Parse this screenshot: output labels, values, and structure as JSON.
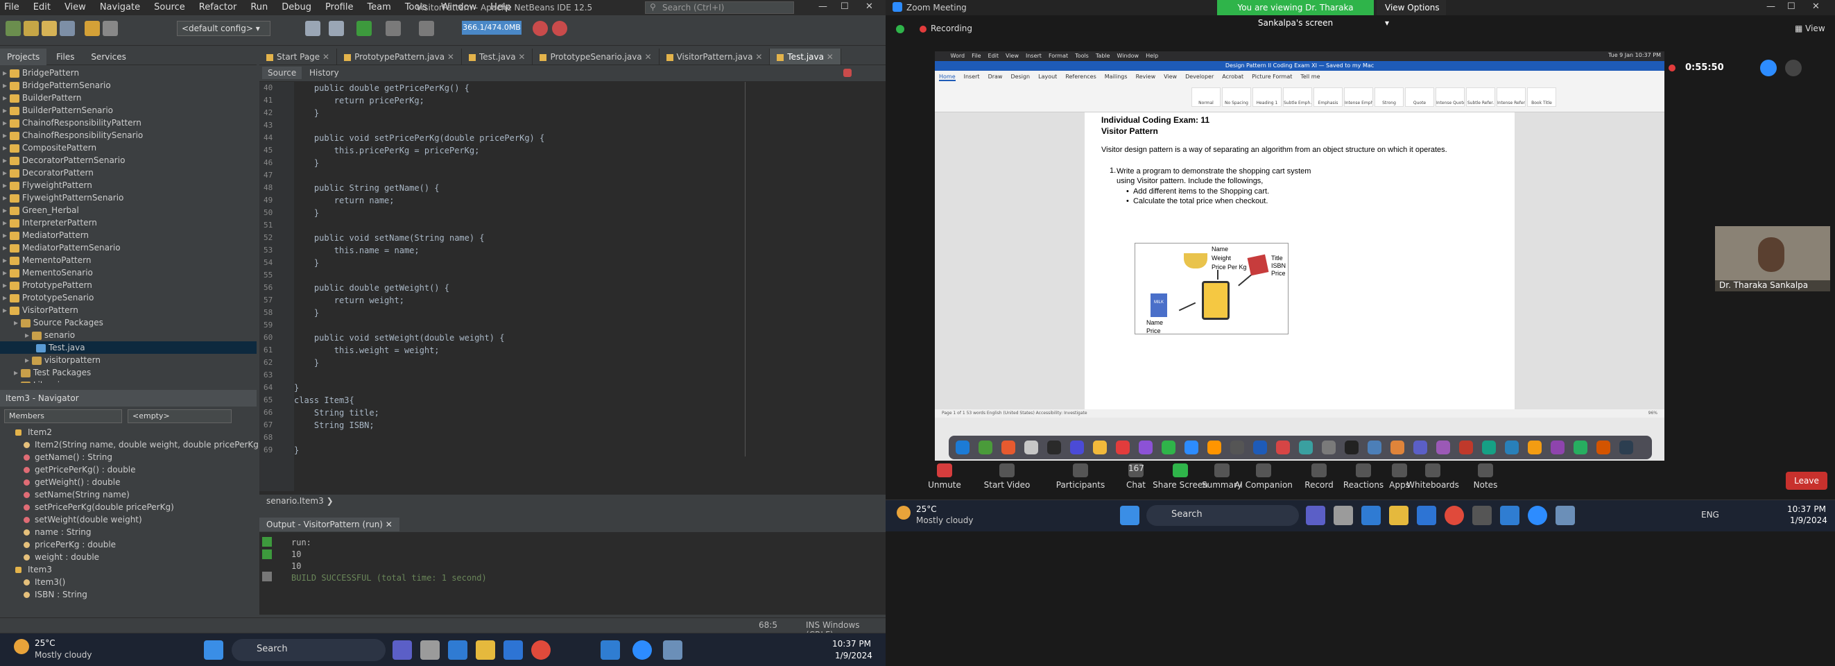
{
  "netbeans": {
    "window_title": "VisitorPattern - Apache NetBeans IDE 12.5",
    "menus": [
      "File",
      "Edit",
      "View",
      "Navigate",
      "Source",
      "Refactor",
      "Run",
      "Debug",
      "Profile",
      "Team",
      "Tools",
      "Window",
      "Help"
    ],
    "search_placeholder": "Search (Ctrl+I)",
    "config": "<default config>",
    "memory": "366.1/474.0MB",
    "panel_tabs": [
      "Projects",
      "Files",
      "Services"
    ],
    "tree": [
      {
        "label": "BridgePattern",
        "indent": 0,
        "type": "proj"
      },
      {
        "label": "BridgePatternSenario",
        "indent": 0,
        "type": "proj"
      },
      {
        "label": "BuilderPattern",
        "indent": 0,
        "type": "proj"
      },
      {
        "label": "BuilderPatternSenario",
        "indent": 0,
        "type": "proj"
      },
      {
        "label": "ChainofResponsibilityPattern",
        "indent": 0,
        "type": "proj"
      },
      {
        "label": "ChainofResponsibilitySenario",
        "indent": 0,
        "type": "proj"
      },
      {
        "label": "CompositePattern",
        "indent": 0,
        "type": "proj"
      },
      {
        "label": "DecoratorPatternSenario",
        "indent": 0,
        "type": "proj"
      },
      {
        "label": "DecoratorPattern",
        "indent": 0,
        "type": "proj"
      },
      {
        "label": "FlyweightPattern",
        "indent": 0,
        "type": "proj"
      },
      {
        "label": "FlyweightPatternSenario",
        "indent": 0,
        "type": "proj"
      },
      {
        "label": "Green_Herbal",
        "indent": 0,
        "type": "proj"
      },
      {
        "label": "InterpreterPattern",
        "indent": 0,
        "type": "proj"
      },
      {
        "label": "MediatorPattern",
        "indent": 0,
        "type": "proj"
      },
      {
        "label": "MediatorPatternSenario",
        "indent": 0,
        "type": "proj"
      },
      {
        "label": "MementoPattern",
        "indent": 0,
        "type": "proj"
      },
      {
        "label": "MementoSenario",
        "indent": 0,
        "type": "proj"
      },
      {
        "label": "PrototypePattern",
        "indent": 0,
        "type": "proj"
      },
      {
        "label": "PrototypeSenario",
        "indent": 0,
        "type": "proj"
      },
      {
        "label": "VisitorPattern",
        "indent": 0,
        "type": "proj"
      },
      {
        "label": "Source Packages",
        "indent": 1,
        "type": "pk"
      },
      {
        "label": "senario",
        "indent": 2,
        "type": "pk"
      },
      {
        "label": "Test.java",
        "indent": 3,
        "type": "jv"
      },
      {
        "label": "visitorpattern",
        "indent": 2,
        "type": "pk"
      },
      {
        "label": "Test Packages",
        "indent": 1,
        "type": "pk"
      },
      {
        "label": "Libraries",
        "indent": 1,
        "type": "pk"
      }
    ],
    "navigator": {
      "title": "Item3 - Navigator",
      "members_label": "Members",
      "empty_label": "<empty>",
      "items": [
        {
          "label": "Item2",
          "cls": true
        },
        {
          "label": "Item2(String name, double weight, double pricePerKg)",
          "k": "g"
        },
        {
          "label": "getName() : String",
          "k": "r"
        },
        {
          "label": "getPricePerKg() : double",
          "k": "r"
        },
        {
          "label": "getWeight() : double",
          "k": "r"
        },
        {
          "label": "setName(String name)",
          "k": "r"
        },
        {
          "label": "setPricePerKg(double pricePerKg)",
          "k": "r"
        },
        {
          "label": "setWeight(double weight)",
          "k": "r"
        },
        {
          "label": "name : String",
          "k": "g"
        },
        {
          "label": "pricePerKg : double",
          "k": "g"
        },
        {
          "label": "weight : double",
          "k": "g"
        },
        {
          "label": "Item3",
          "cls": true
        },
        {
          "label": "Item3()",
          "k": "g"
        },
        {
          "label": "ISBN : String",
          "k": "g"
        }
      ]
    },
    "editor_tabs": [
      "Start Page",
      "PrototypePattern.java",
      "Test.java",
      "PrototypeSenario.java",
      "VisitorPattern.java",
      "Test.java"
    ],
    "source_label": "Source",
    "history_label": "History",
    "code_lines": [
      {
        "n": "40",
        "t": "    public double getPricePerKg() {"
      },
      {
        "n": "41",
        "t": "        return pricePerKg;"
      },
      {
        "n": "42",
        "t": "    }"
      },
      {
        "n": "43",
        "t": ""
      },
      {
        "n": "44",
        "t": "    public void setPricePerKg(double pricePerKg) {"
      },
      {
        "n": "45",
        "t": "        this.pricePerKg = pricePerKg;"
      },
      {
        "n": "46",
        "t": "    }"
      },
      {
        "n": "47",
        "t": ""
      },
      {
        "n": "48",
        "t": "    public String getName() {"
      },
      {
        "n": "49",
        "t": "        return name;"
      },
      {
        "n": "50",
        "t": "    }"
      },
      {
        "n": "51",
        "t": ""
      },
      {
        "n": "52",
        "t": "    public void setName(String name) {"
      },
      {
        "n": "53",
        "t": "        this.name = name;"
      },
      {
        "n": "54",
        "t": "    }"
      },
      {
        "n": "55",
        "t": ""
      },
      {
        "n": "56",
        "t": "    public double getWeight() {"
      },
      {
        "n": "57",
        "t": "        return weight;"
      },
      {
        "n": "58",
        "t": "    }"
      },
      {
        "n": "59",
        "t": ""
      },
      {
        "n": "60",
        "t": "    public void setWeight(double weight) {"
      },
      {
        "n": "61",
        "t": "        this.weight = weight;"
      },
      {
        "n": "62",
        "t": "    }"
      },
      {
        "n": "63",
        "t": ""
      },
      {
        "n": "64",
        "t": "}"
      },
      {
        "n": "65",
        "t": "class Item3{"
      },
      {
        "n": "66",
        "t": "    String title;"
      },
      {
        "n": "67",
        "t": "    String ISBN;"
      },
      {
        "n": "68",
        "t": "    "
      },
      {
        "n": "69",
        "t": "}"
      }
    ],
    "breadcrumb": "senario.Item3",
    "output_tab": "Output - VisitorPattern (run)",
    "output_lines": [
      "run:",
      "10",
      "10",
      "BUILD SUCCESSFUL (total time: 1 second)"
    ],
    "status_pos": "68:5",
    "status_mode": "INS Windows (CRLF)"
  },
  "taskbar": {
    "weather_temp": "25°C",
    "weather_desc": "Mostly cloudy",
    "search": "Search",
    "time": "10:37 PM",
    "date": "1/9/2024",
    "lang": "ENG"
  },
  "zoom": {
    "title": "Zoom Meeting",
    "viewing_banner": "You are viewing Dr. Tharaka Sankalpa's screen",
    "view_options": "View Options",
    "view": "View",
    "recording": "Recording",
    "timer": "0:55:50",
    "pip_name": "Dr. Tharaka Sankalpa",
    "participants_count": "167",
    "controls": [
      "Unmute",
      "Start Video",
      "Participants",
      "Chat",
      "Share Screen",
      "Summary",
      "AI Companion",
      "Record",
      "Reactions",
      "Apps",
      "Whiteboards",
      "Notes"
    ],
    "leave": "Leave",
    "shared": {
      "mac_menu": [
        "Word",
        "File",
        "Edit",
        "View",
        "Insert",
        "Format",
        "Tools",
        "Table",
        "Window",
        "Help"
      ],
      "mac_clock": "Tue 9 Jan 10:37 PM",
      "doc_title": "Design Pattern II Coding Exam XI — Saved to my Mac",
      "ribbon_tabs": [
        "Home",
        "Insert",
        "Draw",
        "Design",
        "Layout",
        "References",
        "Mailings",
        "Review",
        "View",
        "Developer",
        "Acrobat",
        "Picture Format",
        "Tell me"
      ],
      "styles": [
        "Normal",
        "No Spacing",
        "Heading 1",
        "Subtle Emph.",
        "Emphasis",
        "Intense Emph.",
        "Strong",
        "Quote",
        "Intense Quote",
        "Subtle Refer.",
        "Intense Refer.",
        "Book Title"
      ],
      "heading1": "Individual Coding Exam: 11",
      "heading2": "Visitor Pattern",
      "para": "Visitor design pattern is a way of separating an algorithm from an object structure on which it operates.",
      "q_num": "1.",
      "q_text": "Write a program to demonstrate the shopping cart system using Visitor pattern. Include the followings,",
      "bullets": [
        "Add different items to the Shopping cart.",
        "Calculate the total price when checkout."
      ],
      "fig_labels_top": [
        "Name",
        "Weight",
        "Price Per Kg"
      ],
      "fig_labels_right": [
        "Title",
        "ISBN",
        "Price"
      ],
      "fig_labels_left": [
        "Name",
        "Price"
      ],
      "milk": "MILK",
      "doc_status": "Page 1 of 1    53 words    English (United States)    Accessibility: Investigate",
      "zoom_pct": "96%"
    }
  }
}
